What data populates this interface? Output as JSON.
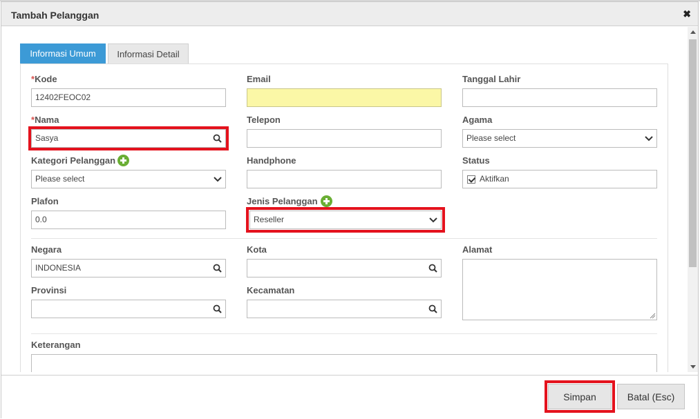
{
  "dialog": {
    "title": "Tambah Pelanggan"
  },
  "tabs": [
    {
      "label": "Informasi Umum",
      "active": true
    },
    {
      "label": "Informasi Detail",
      "active": false
    }
  ],
  "form": {
    "kode": {
      "label": "Kode",
      "value": "12402FEOC02",
      "required": true
    },
    "nama": {
      "label": "Nama",
      "value": "Sasya",
      "required": true
    },
    "kategori": {
      "label": "Kategori Pelanggan",
      "value": "Please select"
    },
    "plafon": {
      "label": "Plafon",
      "value": "0.0"
    },
    "email": {
      "label": "Email",
      "value": ""
    },
    "telepon": {
      "label": "Telepon",
      "value": ""
    },
    "handphone": {
      "label": "Handphone",
      "value": ""
    },
    "jenis": {
      "label": "Jenis Pelanggan",
      "value": "Reseller"
    },
    "tanggal_lahir": {
      "label": "Tanggal Lahir",
      "value": ""
    },
    "agama": {
      "label": "Agama",
      "value": "Please select"
    },
    "status": {
      "label": "Status",
      "checkbox_label": "Aktifkan",
      "checked": true
    },
    "negara": {
      "label": "Negara",
      "value": "INDONESIA"
    },
    "provinsi": {
      "label": "Provinsi",
      "value": ""
    },
    "kota": {
      "label": "Kota",
      "value": ""
    },
    "kecamatan": {
      "label": "Kecamatan",
      "value": ""
    },
    "alamat": {
      "label": "Alamat",
      "value": ""
    },
    "keterangan": {
      "label": "Keterangan",
      "value": ""
    }
  },
  "buttons": {
    "save": "Simpan",
    "cancel": "Batal (Esc)"
  },
  "icons": {
    "close": "close-icon",
    "search": "search-icon",
    "chevron": "chevron-down-icon",
    "add": "add-icon"
  },
  "colors": {
    "active_tab": "#3c9ad6",
    "highlight": "#e4121d",
    "email_bg": "#fbf7a6",
    "add_icon": "#6aae34"
  }
}
